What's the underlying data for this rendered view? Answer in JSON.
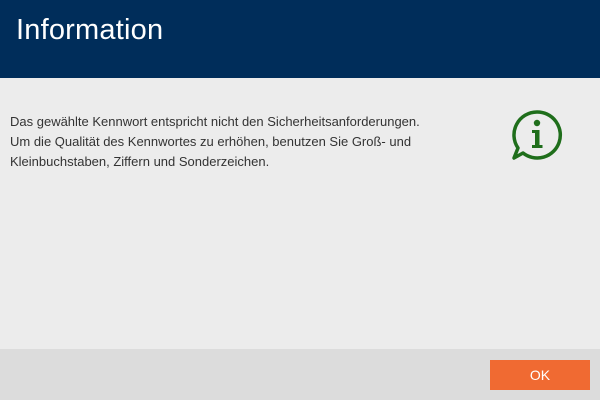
{
  "dialog": {
    "title": "Information",
    "message_lines": [
      "Das gewählte Kennwort entspricht nicht den Sicherheitsanforderungen.",
      "Um die Qualität des Kennwortes zu erhöhen, benutzen Sie Groß- und",
      "Kleinbuchstaben, Ziffern und Sonderzeichen."
    ],
    "icon": "info-speech-bubble-icon",
    "ok_label": "OK"
  },
  "colors": {
    "header_bg": "#002d5a",
    "body_bg": "#ececec",
    "footer_bg": "#dcdcdc",
    "button_bg": "#f06a32",
    "icon_green": "#1f6e1b"
  }
}
